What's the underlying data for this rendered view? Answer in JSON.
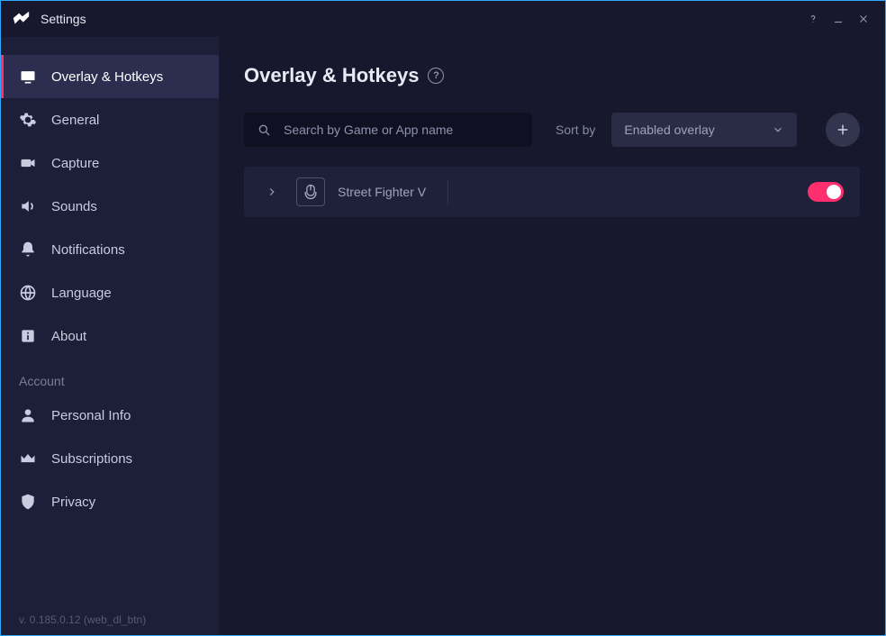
{
  "window": {
    "title": "Settings"
  },
  "sidebar": {
    "items": [
      {
        "label": "Overlay & Hotkeys"
      },
      {
        "label": "General"
      },
      {
        "label": "Capture"
      },
      {
        "label": "Sounds"
      },
      {
        "label": "Notifications"
      },
      {
        "label": "Language"
      },
      {
        "label": "About"
      }
    ],
    "section_account": "Account",
    "account_items": [
      {
        "label": "Personal Info"
      },
      {
        "label": "Subscriptions"
      },
      {
        "label": "Privacy"
      }
    ],
    "version": "v. 0.185.0.12 (web_dl_btn)"
  },
  "page": {
    "title": "Overlay & Hotkeys",
    "help_icon": "?"
  },
  "toolbar": {
    "search_placeholder": "Search by Game or App name",
    "sortby_label": "Sort by",
    "sortby_value": "Enabled overlay",
    "add_button": "+"
  },
  "apps": [
    {
      "name": "Street Fighter V",
      "overlay_enabled": true
    }
  ]
}
